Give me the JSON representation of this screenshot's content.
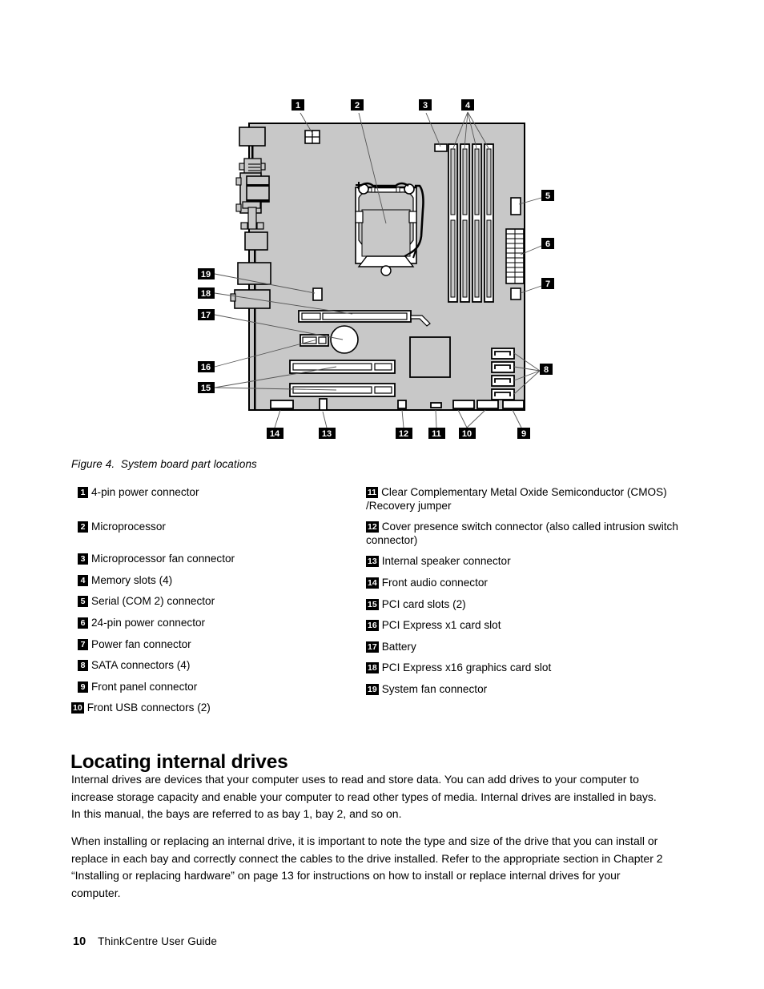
{
  "figure": {
    "caption": "Figure 4.  System board part locations",
    "diagram_name": "system-board-part-locations-diagram",
    "board_color": "#c8c8c8",
    "callout_numbers": [
      "1",
      "2",
      "3",
      "4",
      "5",
      "6",
      "7",
      "8",
      "9",
      "10",
      "11",
      "12",
      "13",
      "14",
      "15",
      "16",
      "17",
      "18",
      "19"
    ]
  },
  "legend": {
    "left": [
      {
        "num": "1",
        "text": "4-pin power connector"
      },
      {
        "num": "2",
        "text": "Microprocessor"
      },
      {
        "num": "3",
        "text": "Microprocessor fan connector"
      },
      {
        "num": "4",
        "text": "Memory slots (4)"
      },
      {
        "num": "5",
        "text": "Serial (COM 2) connector"
      },
      {
        "num": "6",
        "text": "24-pin power connector"
      },
      {
        "num": "7",
        "text": "Power fan connector"
      },
      {
        "num": "8",
        "text": "SATA connectors (4)"
      },
      {
        "num": "9",
        "text": "Front panel connector"
      },
      {
        "num": "10",
        "text": "Front USB connectors (2)"
      }
    ],
    "right": [
      {
        "num": "11",
        "text": "Clear Complementary Metal Oxide Semiconductor (CMOS) /Recovery jumper"
      },
      {
        "num": "12",
        "text": "Cover presence switch connector (also called intrusion switch connector)"
      },
      {
        "num": "13",
        "text": "Internal speaker connector"
      },
      {
        "num": "14",
        "text": "Front audio connector"
      },
      {
        "num": "15",
        "text": "PCI card slots (2)"
      },
      {
        "num": "16",
        "text": "PCI Express x1 card slot"
      },
      {
        "num": "17",
        "text": "Battery"
      },
      {
        "num": "18",
        "text": "PCI Express x16 graphics card slot"
      },
      {
        "num": "19",
        "text": "System fan connector"
      }
    ]
  },
  "section": {
    "heading": "Locating internal drives",
    "paragraph_1": "Internal drives are devices that your computer uses to read and store data.  You can add drives to your computer to increase storage capacity and enable your computer to read other types of media. Internal drives are installed in bays. In this manual, the bays are referred to as bay 1, bay 2, and so on.",
    "paragraph_2": "When installing or replacing an internal drive, it is important to note the type and size of the drive that you can install or replace in each bay and correctly connect the cables to the drive installed.  Refer to the appropriate section in Chapter 2 “Installing or replacing hardware” on page 13 for instructions on how to install or replace internal drives for your computer."
  },
  "footer": {
    "page_number": "10",
    "document_title": "ThinkCentre User Guide"
  }
}
